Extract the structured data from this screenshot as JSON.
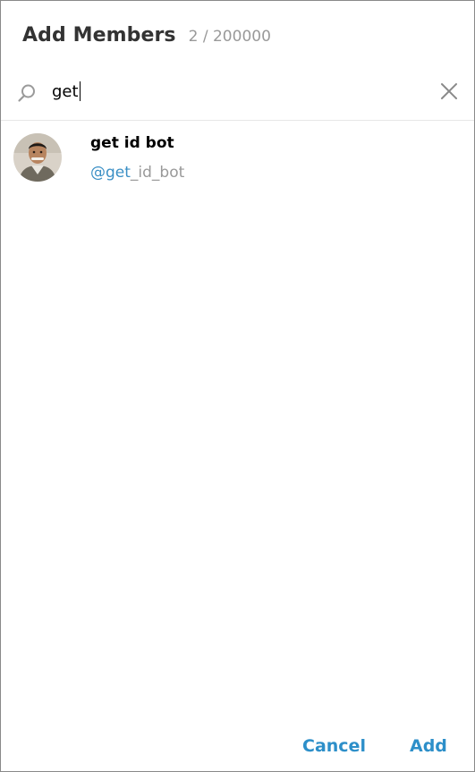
{
  "dialog": {
    "title": "Add Members",
    "counter": "2 / 200000"
  },
  "search": {
    "value": "get",
    "icon": "search-icon",
    "clear_icon": "close-icon"
  },
  "results": [
    {
      "name": "get id bot",
      "username_match": "@get",
      "username_rest": "_id_bot"
    }
  ],
  "buttons": {
    "cancel": "Cancel",
    "add": "Add"
  },
  "colors": {
    "accent": "#2d8fc9",
    "match": "#3a8fc5",
    "muted": "#999999"
  }
}
